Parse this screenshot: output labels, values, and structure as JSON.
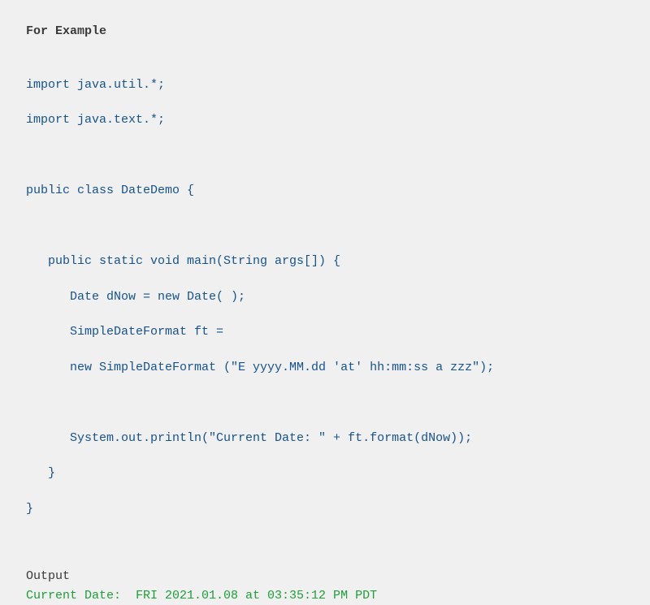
{
  "example_heading": "For Example",
  "code": {
    "l1": "import java.util.*;",
    "l2": "import java.text.*;",
    "l3": "",
    "l4": "public class DateDemo {",
    "l5": "",
    "l6": "   public static void main(String args[]) {",
    "l7": "      Date dNow = new Date( );",
    "l8": "      SimpleDateFormat ft =",
    "l9": "      new SimpleDateFormat (\"E yyyy.MM.dd 'at' hh:mm:ss a zzz\");",
    "l10": "",
    "l11": "      System.out.println(\"Current Date: \" + ft.format(dNow));",
    "l12": "   }",
    "l13": "}"
  },
  "output_heading": "Output",
  "output_line": "Current Date:  FRI 2021.01.08 at 03:35:12 PM PDT"
}
